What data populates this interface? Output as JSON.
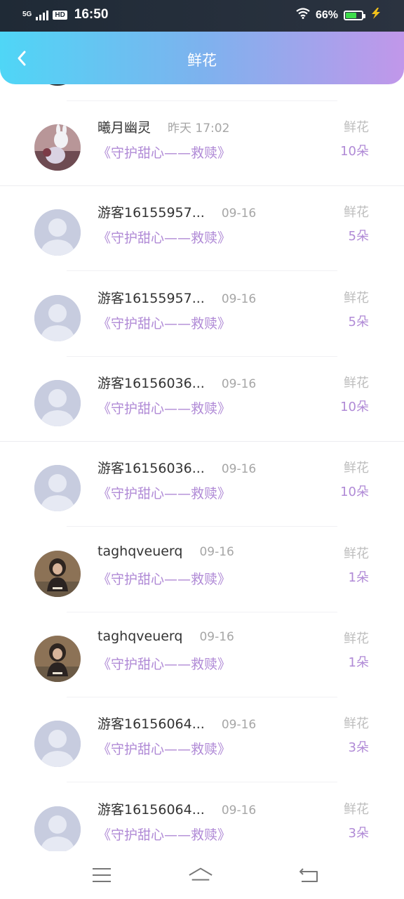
{
  "status_bar": {
    "network": "5G",
    "hd": "HD",
    "time": "16:50",
    "battery_percent": "66%",
    "battery_level": 0.66
  },
  "header": {
    "title": "鲜花",
    "gradient_start": "#4fd6f6",
    "gradient_end": "#c197ea"
  },
  "accent_color": "#b08ad6",
  "records": [
    {
      "name": "曦月幽灵",
      "date": "昨天 17:02",
      "gift": "《守护甜心——救赎》",
      "kind": "鲜花",
      "count": "10朵",
      "avatar": "photo-girl-bunny"
    },
    {
      "name": "游客16155957...",
      "date": "09-16",
      "gift": "《守护甜心——救赎》",
      "kind": "鲜花",
      "count": "5朵",
      "avatar": "default-person-icon"
    },
    {
      "name": "游客16155957...",
      "date": "09-16",
      "gift": "《守护甜心——救赎》",
      "kind": "鲜花",
      "count": "5朵",
      "avatar": "default-person-icon"
    },
    {
      "name": "游客16156036...",
      "date": "09-16",
      "gift": "《守护甜心——救赎》",
      "kind": "鲜花",
      "count": "10朵",
      "avatar": "default-person-icon"
    },
    {
      "name": "游客16156036...",
      "date": "09-16",
      "gift": "《守护甜心——救赎》",
      "kind": "鲜花",
      "count": "10朵",
      "avatar": "default-person-icon"
    },
    {
      "name": "taghqveuerq",
      "date": "09-16",
      "gift": "《守护甜心——救赎》",
      "kind": "鲜花",
      "count": "1朵",
      "avatar": "photo-child"
    },
    {
      "name": "taghqveuerq",
      "date": "09-16",
      "gift": "《守护甜心——救赎》",
      "kind": "鲜花",
      "count": "1朵",
      "avatar": "photo-child"
    },
    {
      "name": "游客16156064...",
      "date": "09-16",
      "gift": "《守护甜心——救赎》",
      "kind": "鲜花",
      "count": "3朵",
      "avatar": "default-person-icon"
    },
    {
      "name": "游客16156064...",
      "date": "09-16",
      "gift": "《守护甜心——救赎》",
      "kind": "鲜花",
      "count": "3朵",
      "avatar": "default-person-icon"
    }
  ],
  "nav_bar": {
    "items": [
      "menu-icon",
      "home-icon",
      "back-icon"
    ]
  }
}
